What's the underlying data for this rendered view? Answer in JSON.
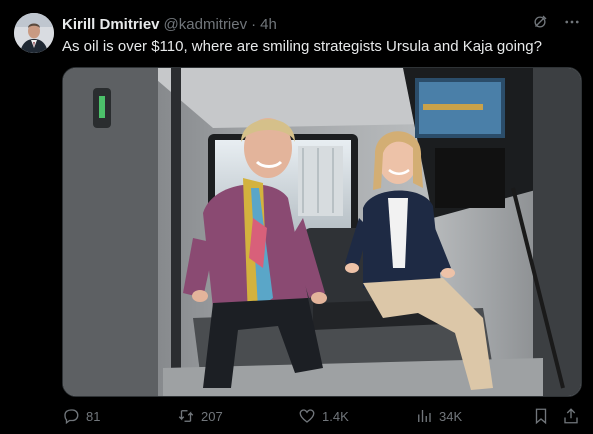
{
  "author": {
    "name": "Kirill Dmitriev",
    "handle": "@kadmitriev",
    "time": "4h",
    "avatar_icon": "profile-photo"
  },
  "tweet": {
    "text": "As oil is over $110, where are smiling strategists Ursula and Kaja going?",
    "media_description_icon": "photo"
  },
  "actions": {
    "replies": "81",
    "reposts": "207",
    "likes": "1.4K",
    "views": "34K"
  },
  "colors": {
    "background": "#000000",
    "text_primary": "#e7e9ea",
    "text_secondary": "#71767b"
  }
}
